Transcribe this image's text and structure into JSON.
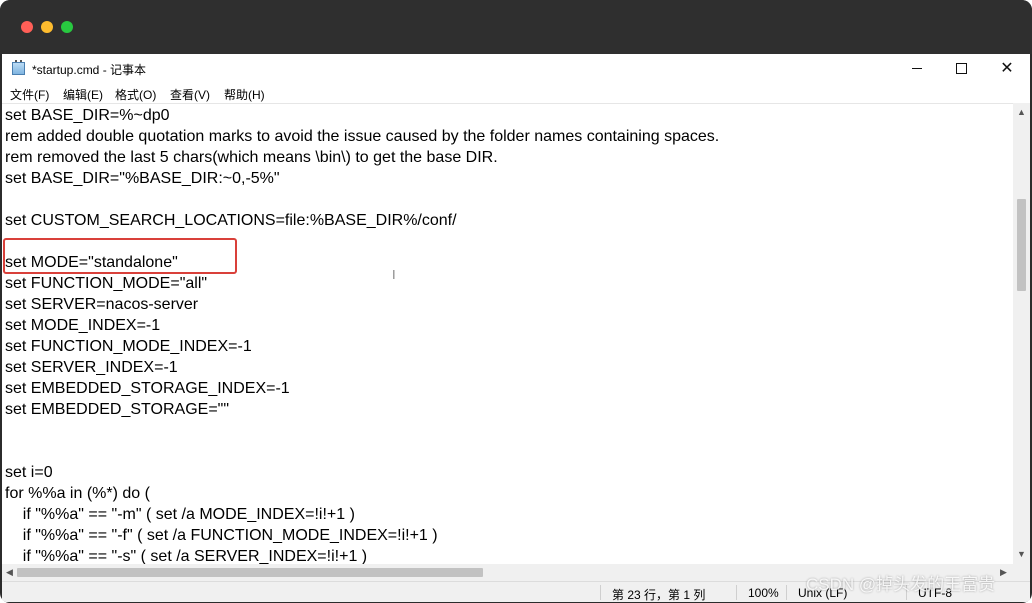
{
  "window": {
    "title": "*startup.cmd - 记事本"
  },
  "menu": [
    "文件(F)",
    "编辑(E)",
    "格式(O)",
    "查看(V)",
    "帮助(H)"
  ],
  "editor": {
    "lines": [
      "set BASE_DIR=%~dp0",
      "rem added double quotation marks to avoid the issue caused by the folder names containing spaces.",
      "rem removed the last 5 chars(which means \\bin\\) to get the base DIR.",
      "set BASE_DIR=\"%BASE_DIR:~0,-5%\"",
      "",
      "set CUSTOM_SEARCH_LOCATIONS=file:%BASE_DIR%/conf/",
      "",
      "set MODE=\"standalone\"",
      "set FUNCTION_MODE=\"all\"",
      "set SERVER=nacos-server",
      "set MODE_INDEX=-1",
      "set FUNCTION_MODE_INDEX=-1",
      "set SERVER_INDEX=-1",
      "set EMBEDDED_STORAGE_INDEX=-1",
      "set EMBEDDED_STORAGE=\"\"",
      "",
      "",
      "set i=0",
      "for %%a in (%*) do (",
      "    if \"%%a\" == \"-m\" ( set /a MODE_INDEX=!i!+1 )",
      "    if \"%%a\" == \"-f\" ( set /a FUNCTION_MODE_INDEX=!i!+1 )",
      "    if \"%%a\" == \"-s\" ( set /a SERVER_INDEX=!i!+1 )"
    ],
    "highlighted_line": "set MODE=\"standalone\""
  },
  "status": {
    "position": "第 23 行，第 1 列",
    "zoom": "100%",
    "line_ending": "Unix (LF)",
    "encoding": "UTF-8"
  },
  "watermark": "CSDN @掉头发的王富贵",
  "colors": {
    "highlight_border": "#d9403a",
    "close_dot": "#ff5f57",
    "minimize_dot": "#febc2e",
    "zoom_dot": "#28c840"
  }
}
